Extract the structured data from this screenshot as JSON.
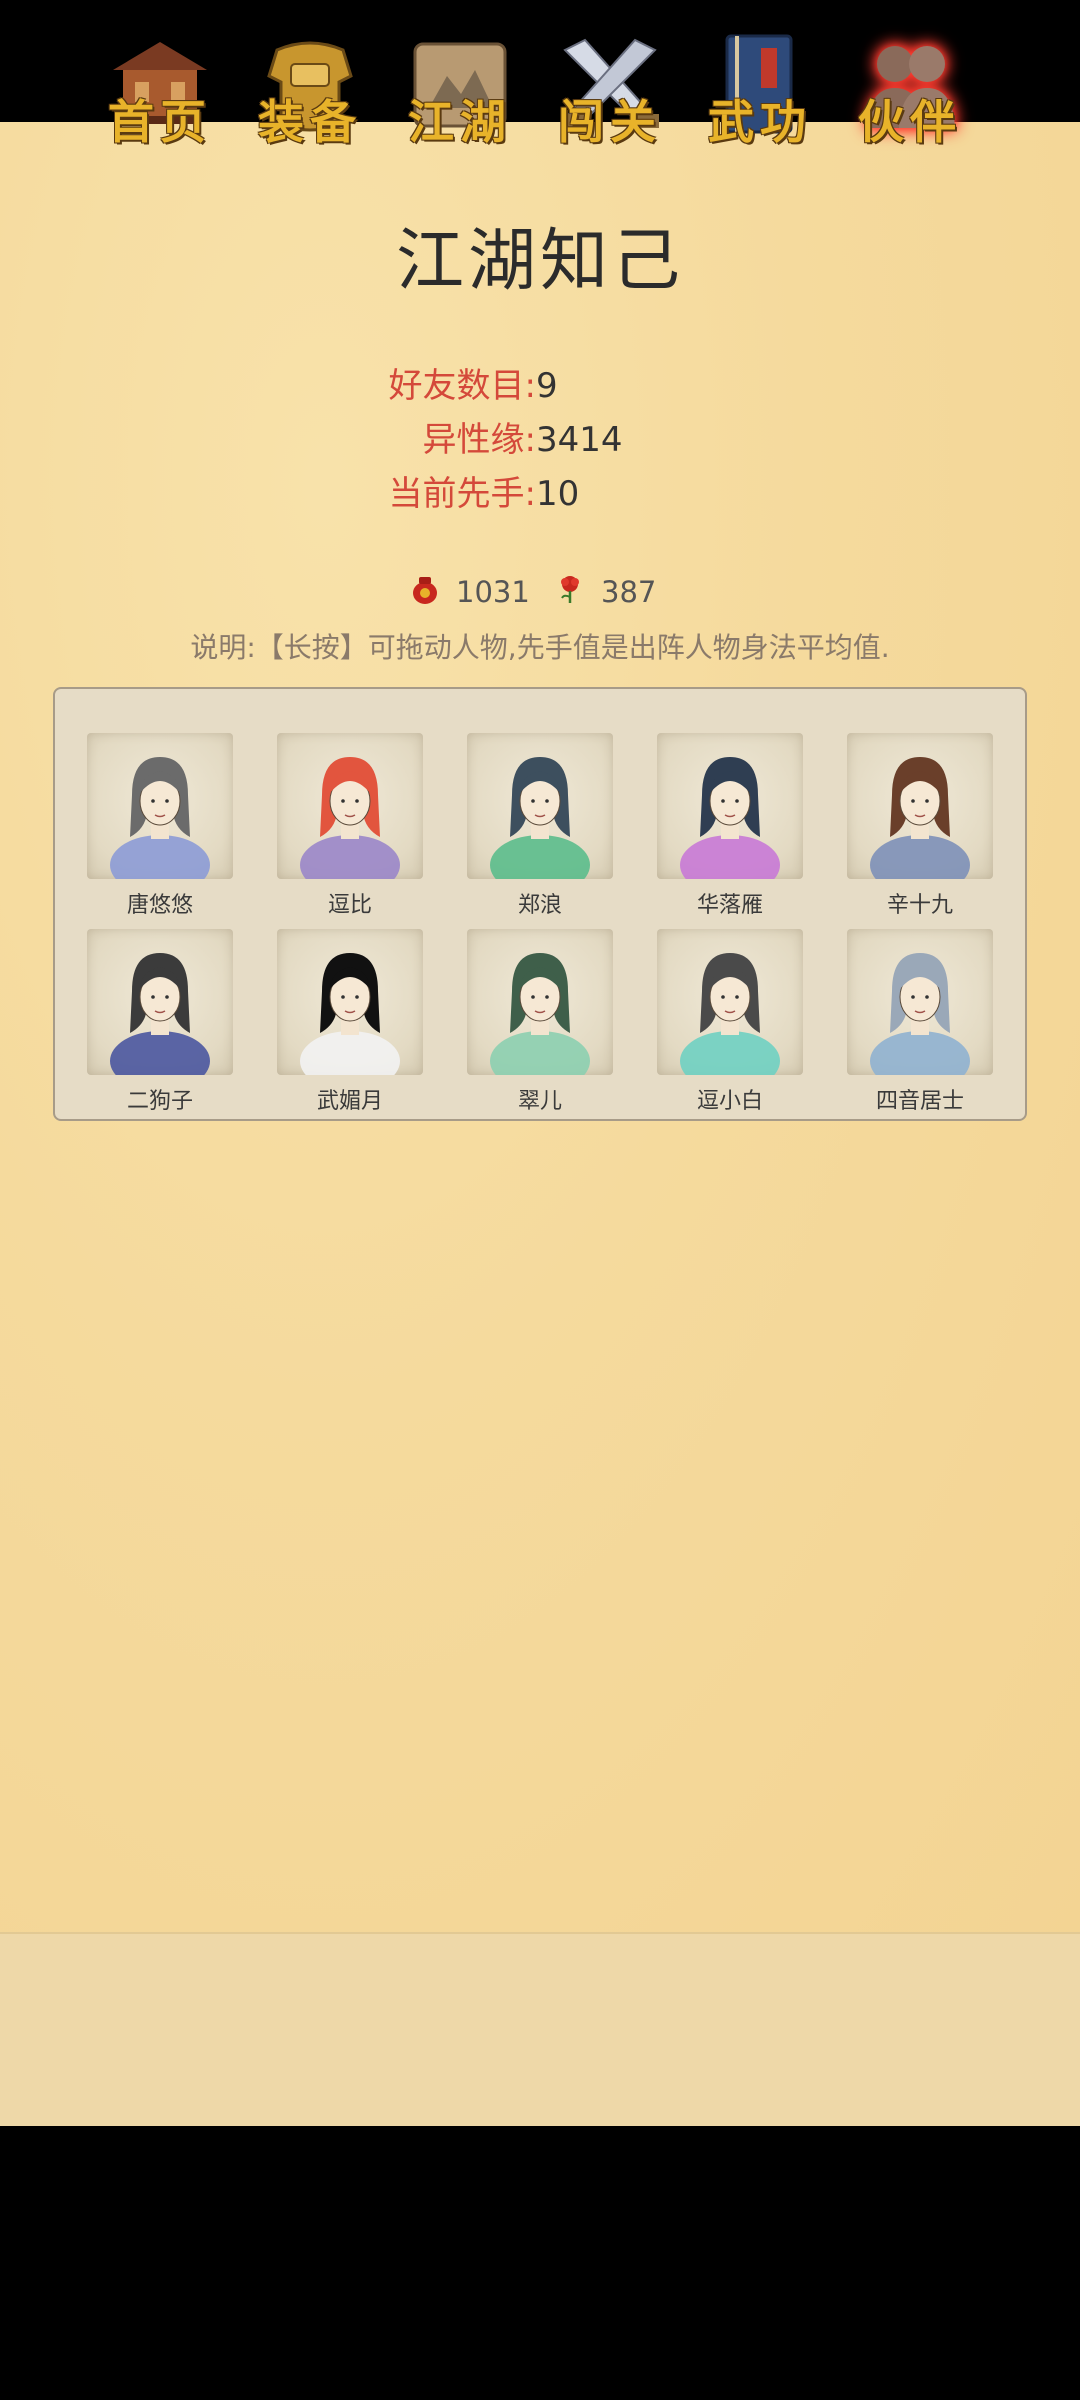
{
  "header": {
    "title": "江湖知己"
  },
  "stats": [
    {
      "label": "好友数目:",
      "value": "9"
    },
    {
      "label": "异性缘:",
      "value": "3414"
    },
    {
      "label": "当前先手:",
      "value": "10"
    }
  ],
  "resources": [
    {
      "icon": "red-pouch-icon",
      "value": "1031"
    },
    {
      "icon": "red-flower-icon",
      "value": "387"
    }
  ],
  "note": "说明:【长按】可拖动人物,先手值是出阵人物身法平均值.",
  "characters": [
    {
      "name": "唐悠悠",
      "hair": "#6b6b6b",
      "clothes": "#8c9bd6"
    },
    {
      "name": "逗比",
      "hair": "#e2553e",
      "clothes": "#9a86c9"
    },
    {
      "name": "郑浪",
      "hair": "#3d4f5e",
      "clothes": "#5bbd8c"
    },
    {
      "name": "华落雁",
      "hair": "#2f3e52",
      "clothes": "#c879d6"
    },
    {
      "name": "辛十九",
      "hair": "#6a3f2a",
      "clothes": "#7d90b8"
    },
    {
      "name": "二狗子",
      "hair": "#3b3b3b",
      "clothes": "#4a56a0"
    },
    {
      "name": "武媚月",
      "hair": "#111111",
      "clothes": "#f2f2f2"
    },
    {
      "name": "翠儿",
      "hair": "#3f5f4a",
      "clothes": "#8ccfb0"
    },
    {
      "name": "逗小白",
      "hair": "#4a4a4a",
      "clothes": "#6fd0c2"
    },
    {
      "name": "四音居士",
      "hair": "#9aa8b8",
      "clothes": "#8fb1d0"
    }
  ],
  "nav": [
    {
      "label": "首页",
      "icon": "house-icon",
      "active": false
    },
    {
      "label": "装备",
      "icon": "armor-icon",
      "active": false
    },
    {
      "label": "江湖",
      "icon": "scroll-map-icon",
      "active": false
    },
    {
      "label": "闯关",
      "icon": "crossed-swords-icon",
      "active": false
    },
    {
      "label": "武功",
      "icon": "book-icon",
      "active": false
    },
    {
      "label": "伙伴",
      "icon": "companions-icon",
      "active": true
    }
  ]
}
